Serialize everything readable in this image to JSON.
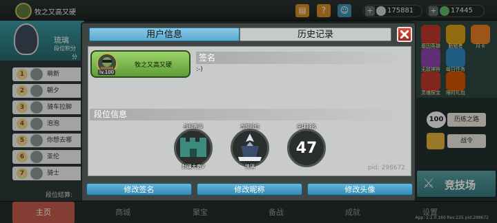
{
  "top_bar": {
    "player_name": "牧之又高又硬",
    "coins": "175881",
    "gems": "17445",
    "icons": [
      "book-icon",
      "help-icon",
      "friends-icon",
      "mail-icon"
    ]
  },
  "left_panel": {
    "ranking_title": "琉璃",
    "ranking_sub": "段位积分",
    "ranking_extra": "分",
    "entries": [
      {
        "rank": "1",
        "name": "萌新"
      },
      {
        "rank": "2",
        "name": "朝夕"
      },
      {
        "rank": "3",
        "name": "骑车拉脚"
      },
      {
        "rank": "4",
        "name": "泡泡"
      },
      {
        "rank": "5",
        "name": "你想去哪"
      },
      {
        "rank": "6",
        "name": "亚伦"
      },
      {
        "rank": "7",
        "name": "骑士"
      }
    ],
    "footer": "段位结算:"
  },
  "right_panel": {
    "icons": [
      {
        "label": "基因英雄",
        "color": "#c0392b"
      },
      {
        "label": "勤勉者",
        "color": "#d4a017"
      },
      {
        "label": "月卡",
        "color": "#e67e22"
      },
      {
        "label": "无敌神将",
        "color": "#8e44ad"
      },
      {
        "label": "每日任务",
        "color": "#2e86c1"
      },
      {
        "label": "灵魂探宝",
        "color": "#c0392b"
      },
      {
        "label": "限时礼包",
        "color": "#d35400"
      }
    ],
    "level": "100",
    "event_label": "历练之路",
    "token_label": "战令",
    "arena_label": "竞技场"
  },
  "bottom_nav": {
    "items": [
      "主页",
      "商城",
      "聚宝",
      "备战",
      "成就",
      "设置"
    ],
    "version": "App: 1.2.0.160 Res:225 pid:298672"
  },
  "modal": {
    "tabs": {
      "active": "用户信息",
      "inactive": "历史记录"
    },
    "user": {
      "name": "牧之又高又硬",
      "level": "lv.100"
    },
    "signature": {
      "title": "签名",
      "text": ":-)"
    },
    "rank_section_title": "段位信息",
    "badges": [
      {
        "caption": "战役等级",
        "label": "封疆大吏V"
      },
      {
        "caption": "当前段位",
        "label": "琉璃"
      },
      {
        "caption": "全球排名",
        "value": "47"
      }
    ],
    "pid": "pid: 298672",
    "buttons": {
      "edit_signature": "修改签名",
      "edit_nickname": "修改昵称",
      "edit_avatar": "修改头像"
    }
  }
}
